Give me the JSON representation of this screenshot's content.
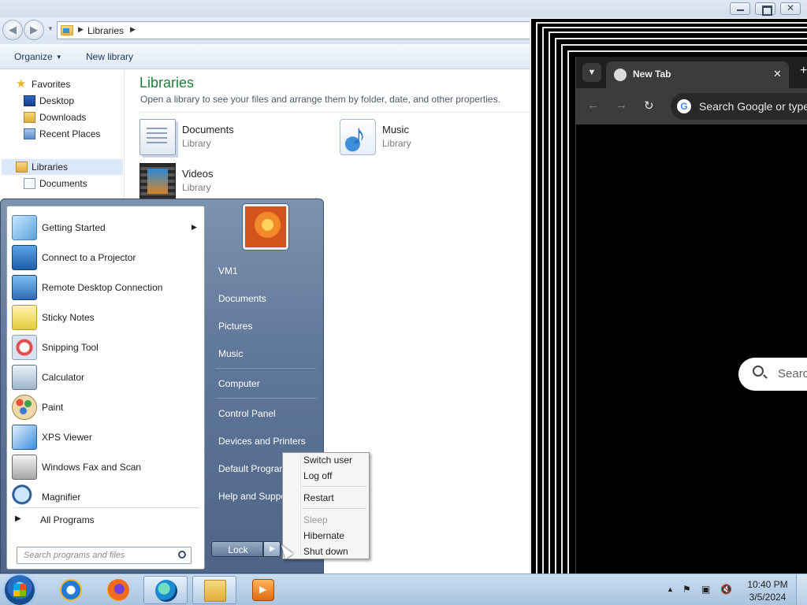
{
  "explorer": {
    "address": {
      "current": "Libraries"
    },
    "commands": {
      "organize": "Organize",
      "new_library": "New library"
    },
    "nav": {
      "favorites": "Favorites",
      "desktop": "Desktop",
      "downloads": "Downloads",
      "recent_places": "Recent Places",
      "libraries": "Libraries",
      "documents": "Documents"
    },
    "content": {
      "title": "Libraries",
      "subtitle": "Open a library to see your files and arrange them by folder, date, and other properties.",
      "items": [
        {
          "name": "Documents",
          "type": "Library",
          "icon": "documents-library-icon"
        },
        {
          "name": "Music",
          "type": "Library",
          "icon": "music-library-icon"
        },
        {
          "name": "Videos",
          "type": "Library",
          "icon": "videos-library-icon"
        }
      ]
    }
  },
  "chrome": {
    "tab_title": "New Tab",
    "omnibox_placeholder": "Search Google or type",
    "ntp_search_placeholder": "Searc"
  },
  "start_menu": {
    "programs": [
      {
        "label": "Getting Started",
        "icon": "getting-started-icon",
        "has_submenu": true
      },
      {
        "label": "Connect to a Projector",
        "icon": "projector-icon"
      },
      {
        "label": "Remote Desktop Connection",
        "icon": "remote-desktop-icon"
      },
      {
        "label": "Sticky Notes",
        "icon": "sticky-notes-icon"
      },
      {
        "label": "Snipping Tool",
        "icon": "snipping-tool-icon"
      },
      {
        "label": "Calculator",
        "icon": "calculator-icon"
      },
      {
        "label": "Paint",
        "icon": "paint-icon"
      },
      {
        "label": "XPS Viewer",
        "icon": "xps-viewer-icon"
      },
      {
        "label": "Windows Fax and Scan",
        "icon": "fax-scan-icon"
      },
      {
        "label": "Magnifier",
        "icon": "magnifier-icon"
      }
    ],
    "all_programs": "All Programs",
    "search_placeholder": "Search programs and files",
    "right_links": {
      "user": "VM1",
      "documents": "Documents",
      "pictures": "Pictures",
      "music": "Music",
      "computer": "Computer",
      "control_panel": "Control Panel",
      "devices_printers": "Devices and Printers",
      "default_programs": "Default Programs",
      "help_support": "Help and Support"
    },
    "lock_label": "Lock"
  },
  "power_menu": {
    "switch_user": "Switch user",
    "log_off": "Log off",
    "restart": "Restart",
    "sleep": "Sleep",
    "hibernate": "Hibernate",
    "shut_down": "Shut down"
  },
  "taskbar": {
    "apps": [
      "internet-explorer-icon",
      "firefox-icon",
      "edge-icon",
      "windows-explorer-icon",
      "media-player-icon"
    ],
    "clock_time": "10:40 PM",
    "clock_date": "3/5/2024"
  }
}
